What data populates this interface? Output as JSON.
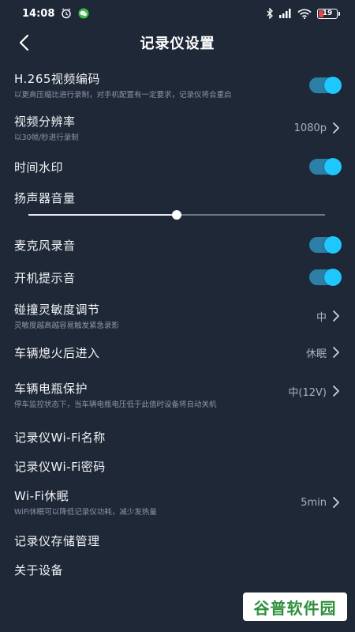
{
  "status_bar": {
    "time": "14:08",
    "icons": [
      "alarm-icon",
      "wechat-icon",
      "bluetooth-icon",
      "signal-icon",
      "wifi-icon"
    ],
    "battery": "19",
    "battery_color": "#e04848"
  },
  "header": {
    "title": "记录仪设置",
    "back_icon": "chevron-left-icon"
  },
  "settings": {
    "h265": {
      "label": "H.265视频编码",
      "sub": "以更高压缩比进行录制，对手机配置有一定要求，记录仪将会重启",
      "enabled": true
    },
    "resolution": {
      "label": "视频分辨率",
      "sub": "以30帧/秒进行录制",
      "value": "1080p"
    },
    "watermark": {
      "label": "时间水印",
      "enabled": true
    },
    "speaker": {
      "label": "扬声器音量",
      "level": 0.5
    },
    "mic": {
      "label": "麦克风录音",
      "enabled": true
    },
    "boot_sound": {
      "label": "开机提示音",
      "enabled": true
    },
    "collision": {
      "label": "碰撞灵敏度调节",
      "sub": "灵敏度越高越容易触发紧急录影",
      "value": "中"
    },
    "after_off": {
      "label": "车辆熄火后进入",
      "value": "休眠"
    },
    "battery_protect": {
      "label": "车辆电瓶保护",
      "sub": "停车监控状态下，当车辆电瓶电压低于此值时设备将自动关机",
      "value": "中(12V)"
    },
    "wifi_name": {
      "label": "记录仪Wi-Fi名称"
    },
    "wifi_password": {
      "label": "记录仪Wi-Fi密码"
    },
    "wifi_sleep": {
      "label": "Wi-Fi休眠",
      "sub": "WiFi休眠可以降低记录仪功耗，减少发热量",
      "value": "5min"
    },
    "storage": {
      "label": "记录仪存储管理"
    },
    "about": {
      "label": "关于设备"
    }
  },
  "colors": {
    "background": "#1e2837",
    "toggle_track": "#2c7fa6",
    "toggle_knob": "#1ec8ff"
  },
  "watermark_logo": {
    "text": "谷普软件园",
    "color": "#2f8f3a"
  }
}
